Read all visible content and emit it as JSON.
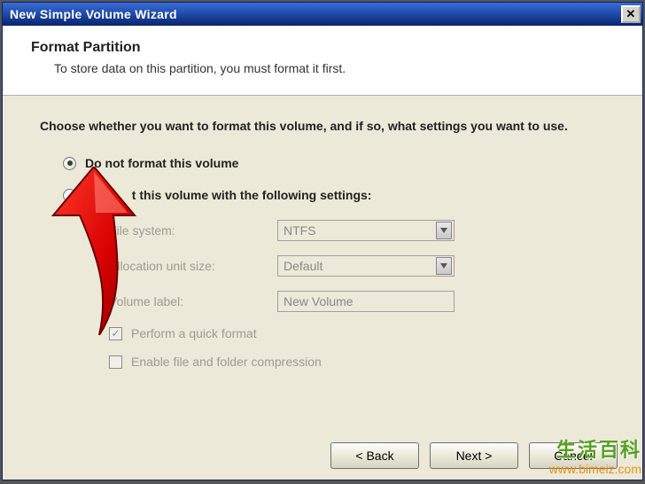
{
  "window": {
    "title": "New Simple Volume Wizard"
  },
  "header": {
    "title": "Format Partition",
    "subtitle": "To store data on this partition, you must format it first."
  },
  "content": {
    "instruction": "Choose whether you want to format this volume, and if so, what settings you want to use.",
    "option_noformat": "Do not format this volume",
    "option_format_suffix": "t this volume with the following settings:"
  },
  "fields": {
    "filesystem_label": "File system:",
    "filesystem_value": "NTFS",
    "alloc_label": "Allocation unit size:",
    "alloc_value": "Default",
    "vollabel_label": "Volume label:",
    "vollabel_value": "New Volume",
    "quickformat": "Perform a quick format",
    "compression": "Enable file and folder compression"
  },
  "buttons": {
    "back": "< Back",
    "next": "Next >",
    "cancel": "Cancel"
  },
  "watermark": {
    "line1": "生活百科",
    "line2": "www.bimeiz.com"
  }
}
